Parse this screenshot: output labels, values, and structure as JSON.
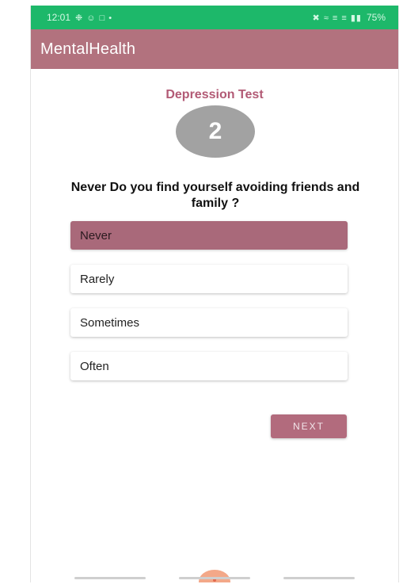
{
  "status_bar": {
    "time": "12:01",
    "left_icons": "❉ ☺ □ •",
    "right_icons": "✖ ≈ ≡ ≡ ▮▮",
    "battery": "75%"
  },
  "app_bar": {
    "title": "MentalHealth"
  },
  "test": {
    "title": "Depression Test",
    "question_number": "2",
    "question_text": "Never Do you find yourself avoiding friends and family ?"
  },
  "options": [
    {
      "label": "Never",
      "selected": true
    },
    {
      "label": "Rarely",
      "selected": false
    },
    {
      "label": "Sometimes",
      "selected": false
    },
    {
      "label": "Often",
      "selected": false
    }
  ],
  "next_label": "NEXT",
  "colors": {
    "status_bar": "#1db86a",
    "app_bar": "#b2727e",
    "accent_text": "#b25a75",
    "selected_option": "#a9697a",
    "circle": "#a2a2a2"
  }
}
